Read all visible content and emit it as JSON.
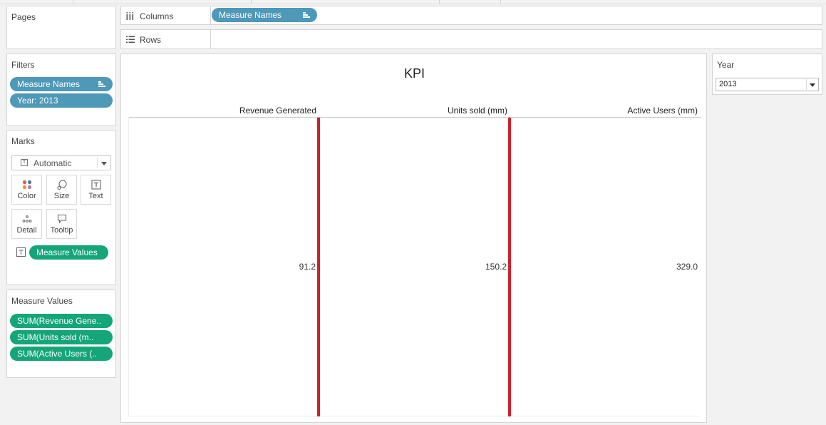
{
  "pages": {
    "title": "Pages"
  },
  "filters": {
    "title": "Filters",
    "items": [
      "Measure Names",
      "Year: 2013"
    ]
  },
  "marks": {
    "title": "Marks",
    "type": "Automatic",
    "buttons": [
      "Color",
      "Size",
      "Text",
      "Detail",
      "Tooltip"
    ],
    "text_pill": "Measure Values"
  },
  "measure_values": {
    "title": "Measure Values",
    "items": [
      "SUM(Revenue Gene..",
      "SUM(Units sold (m..",
      "SUM(Active Users (.."
    ]
  },
  "columns": {
    "label": "Columns",
    "pill": "Measure Names"
  },
  "rows": {
    "label": "Rows"
  },
  "view": {
    "title": "KPI",
    "headers": [
      "Revenue Generated",
      "Units sold (mm)",
      "Active Users (mm)"
    ],
    "values": [
      "91.2",
      "150.2",
      "329.0"
    ]
  },
  "year_filter": {
    "title": "Year",
    "selected": "2013"
  },
  "colors": {
    "dimension_pill": "#4e98b8",
    "measure_pill": "#14a578",
    "divider": "#d0202e"
  }
}
